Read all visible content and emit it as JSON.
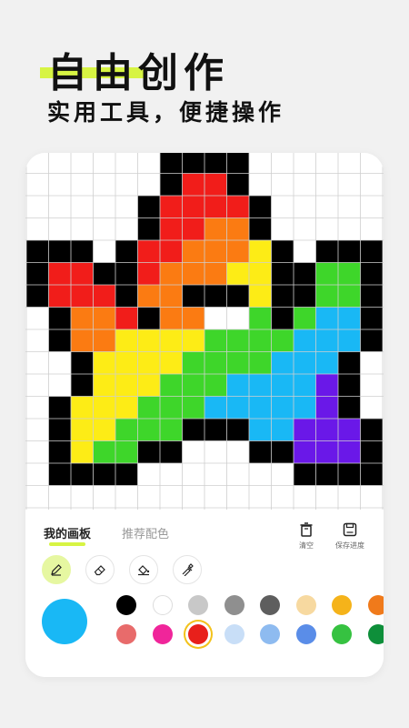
{
  "promo": {
    "headline": "自由创作",
    "subheadline": "实用工具，便捷操作"
  },
  "canvas": {
    "grid_cols": 16,
    "grid_rows": 16,
    "pixel_colors": {
      "K": "#000000",
      "R": "#f11d1a",
      "O": "#fb7b12",
      "Y": "#fdec16",
      "G": "#3ed62a",
      "B": "#19b8f5",
      "P": "#6a18e8",
      "W": "#ffffff",
      ".": "#ffffff"
    },
    "rows": [
      "......KKKK......",
      "......KRRK......",
      ".....KRRRRK.....",
      ".....KRROOK.....",
      "KKK.KRROOOYK.KKK",
      "KRRKKROOOYYKKGGK",
      "KRRRKOOKKKYKKGGK",
      ".KOORKOOWWGKGBBK",
      ".KOOYYYYGGGGBBBK",
      "..KYYYYGGGGBBBK.",
      "..KYYYGGGBBBBPK.",
      ".KYYYGGGBBBBBPK.",
      ".KYYGGGKKKBBPPPK",
      ".KYGGKK...KKPPPK",
      ".KKKK.......KKKK",
      "................"
    ]
  },
  "panel": {
    "tabs": [
      {
        "label": "我的画板",
        "active": true
      },
      {
        "label": "推荐配色",
        "active": false
      }
    ],
    "actions": [
      {
        "label": "清空",
        "icon": "trash-icon"
      },
      {
        "label": "保存进度",
        "icon": "save-icon"
      }
    ],
    "tools": [
      {
        "name": "pencil",
        "icon": "pencil-icon",
        "active": true
      },
      {
        "name": "eraser",
        "icon": "eraser-icon",
        "active": false
      },
      {
        "name": "paint-bucket",
        "icon": "paint-bucket-icon",
        "active": false
      },
      {
        "name": "eyedropper",
        "icon": "eyedropper-icon",
        "active": false
      }
    ],
    "current_color": "#19b8f5",
    "palette_row1": [
      "#000000",
      "#ffffff",
      "#c8c8c8",
      "#8f8f8f",
      "#5e5e5e",
      "#f7d9a0",
      "#f5b31a",
      "#f07a1b"
    ],
    "palette_row2": [
      "#e86b6b",
      "#f0259a",
      "#e8201b",
      "#c8def7",
      "#8ebbf0",
      "#5a8de8",
      "#36c241",
      "#0e8f3a"
    ],
    "selected_swatch": "#e8201b"
  }
}
